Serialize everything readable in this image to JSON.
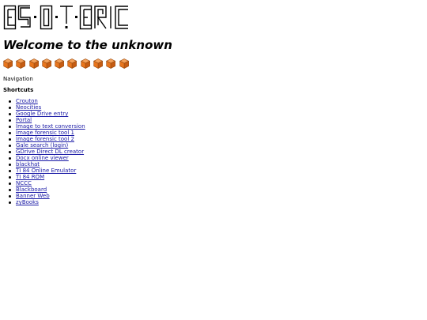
{
  "logo": {
    "text": "ESOTERIC",
    "color": "#000000"
  },
  "headline": "Welcome to the unknown",
  "cubes": {
    "count": 10,
    "icon": "orange-cube-icon",
    "color": "#e8761e"
  },
  "navigation_label": "Navigation",
  "shortcuts": {
    "title": "Shortcuts",
    "link_color": "#1a1aa6",
    "items": [
      {
        "label": "Crouton"
      },
      {
        "label": "Neocities"
      },
      {
        "label": "Google Drive entry"
      },
      {
        "label": "Portal"
      },
      {
        "label": "Image to text conversion"
      },
      {
        "label": "Image forensic tool 1"
      },
      {
        "label": "Image forensic tool 2"
      },
      {
        "label": "Gale search (login)"
      },
      {
        "label": "GDrive Direct DL creator"
      },
      {
        "label": "Docx online viewer"
      },
      {
        "label": "blackhat"
      },
      {
        "label": "TI 84 Online Emulator"
      },
      {
        "label": "TI 84 ROM"
      },
      {
        "label": "NCCC"
      },
      {
        "label": "Blackboard"
      },
      {
        "label": "Banner Web"
      },
      {
        "label": "zyBooks"
      }
    ]
  }
}
